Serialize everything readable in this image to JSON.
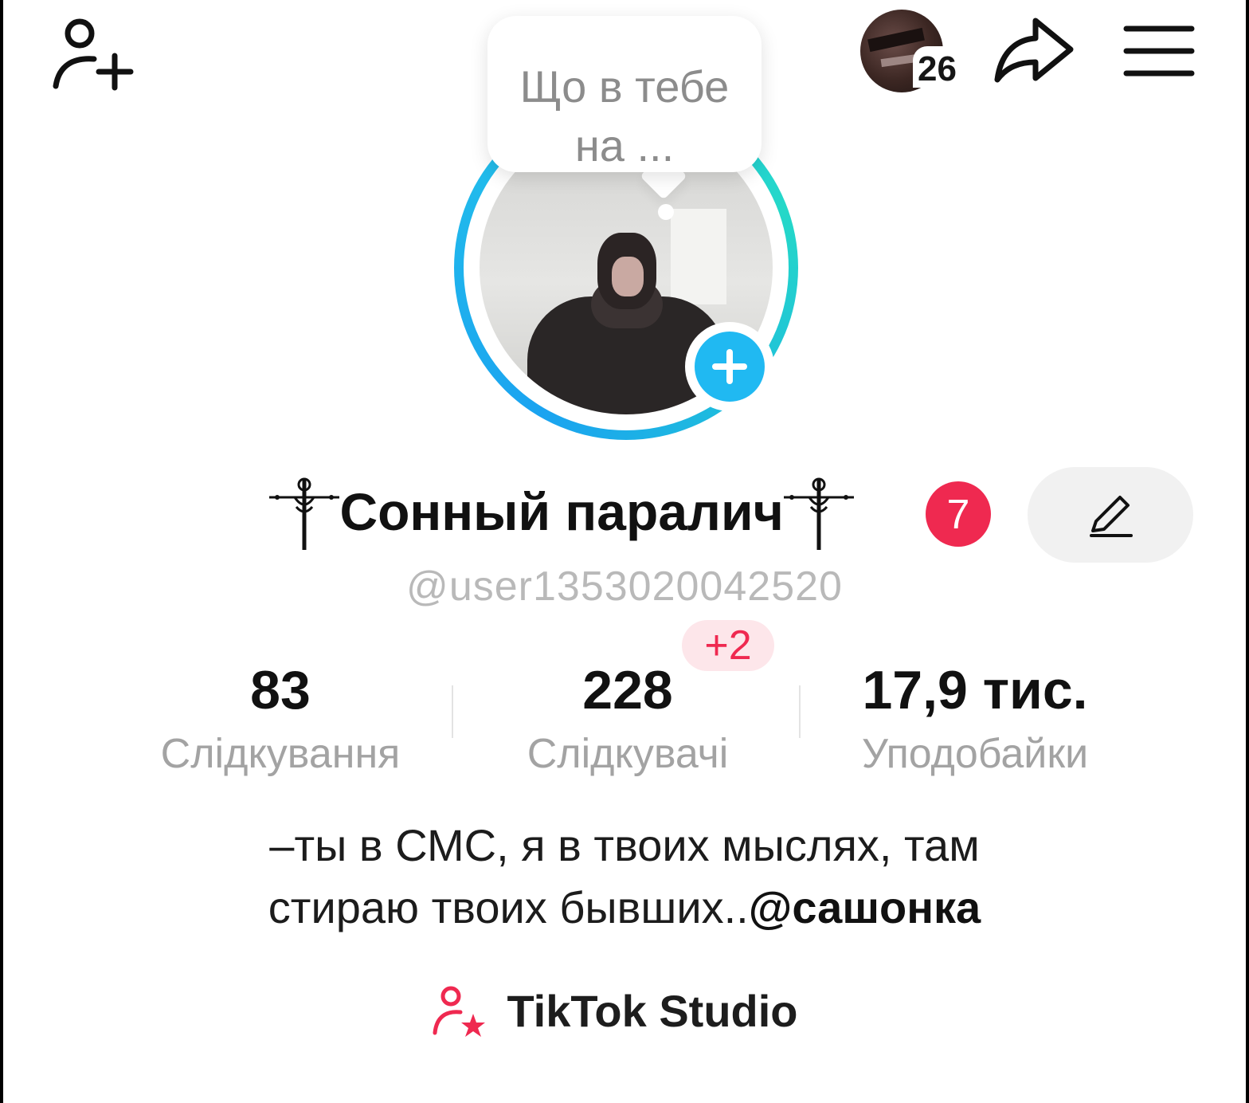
{
  "header": {
    "add_friend_icon": "add-user-icon",
    "notifications_count": "26",
    "share_icon": "share-arrow-icon",
    "menu_icon": "hamburger-menu-icon"
  },
  "note_bubble": {
    "text": "Що в тебе на ..."
  },
  "profile": {
    "display_name": "Сонный паралич",
    "name_decoration_icon": "ornate-cross-icon",
    "badge_count": "7",
    "username": "@user1353020042520",
    "edit_icon": "pencil-icon",
    "add_story_icon": "plus-icon"
  },
  "stats": {
    "following": {
      "value": "83",
      "label": "Слідкування"
    },
    "followers": {
      "value": "228",
      "label": "Слідкувачі",
      "new_badge": "+2"
    },
    "likes": {
      "value": "17,9 тис.",
      "label": "Уподобайки"
    }
  },
  "bio": {
    "line1": "–ты в СМС, я в твоих мыслях, там",
    "line2_text": "стираю твоих бывших..",
    "line2_mention": "@сашонка"
  },
  "studio": {
    "label": "TikTok Studio",
    "icon": "user-star-icon"
  },
  "colors": {
    "accent_red": "#ef2950",
    "ring_blue": "#1aa3f0",
    "ring_teal": "#24d8c8",
    "plus_blue": "#20b9f2",
    "muted_text": "#a3a3a3"
  }
}
